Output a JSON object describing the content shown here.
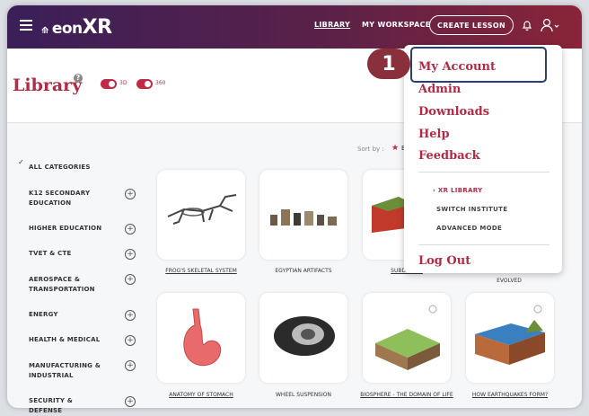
{
  "topbar": {
    "logo_text": "eon",
    "logo_xr": "XR",
    "nav_library": "LIBRARY",
    "nav_workspace": "MY WORKSPACE",
    "create_lesson": "CREATE LESSON"
  },
  "header": {
    "title": "Library",
    "toggle_3d": "3D",
    "toggle_360": "360"
  },
  "sort": {
    "label": "Sort by :",
    "value": "E"
  },
  "categories": [
    "ALL CATEGORIES",
    "K12 SECONDARY EDUCATION",
    "HIGHER EDUCATION",
    "TVET & CTE",
    "AEROSPACE & TRANSPORTATION",
    "ENERGY",
    "HEALTH & MEDICAL",
    "MANUFACTURING & INDUSTRIAL",
    "SECURITY & DEFENSE"
  ],
  "cards": [
    "FROG'S SKELETAL SYSTEM",
    "EGYPTIAN ARTIFACTS",
    "SUBDUCTIO",
    "EVOLVED",
    "ANATOMY OF STOMACH",
    "WHEEL SUSPENSION",
    "BIOSPHERE - THE DOMAIN OF LIFE",
    "HOW EARTHQUAKES FORM?"
  ],
  "dropdown": {
    "my_account": "My Account",
    "admin": "Admin",
    "downloads": "Downloads",
    "help": "Help",
    "feedback": "Feedback",
    "xr_library": "XR LIBRARY",
    "switch_institute": "SWITCH INSTITUTE",
    "advanced_mode": "ADVANCED MODE",
    "logout": "Log Out"
  },
  "annotation": {
    "step": "1"
  },
  "colors": {
    "brand": "#b42a45",
    "topbar_start": "#3a1f59",
    "topbar_end": "#8a2438",
    "highlight": "#2c3e6b"
  }
}
